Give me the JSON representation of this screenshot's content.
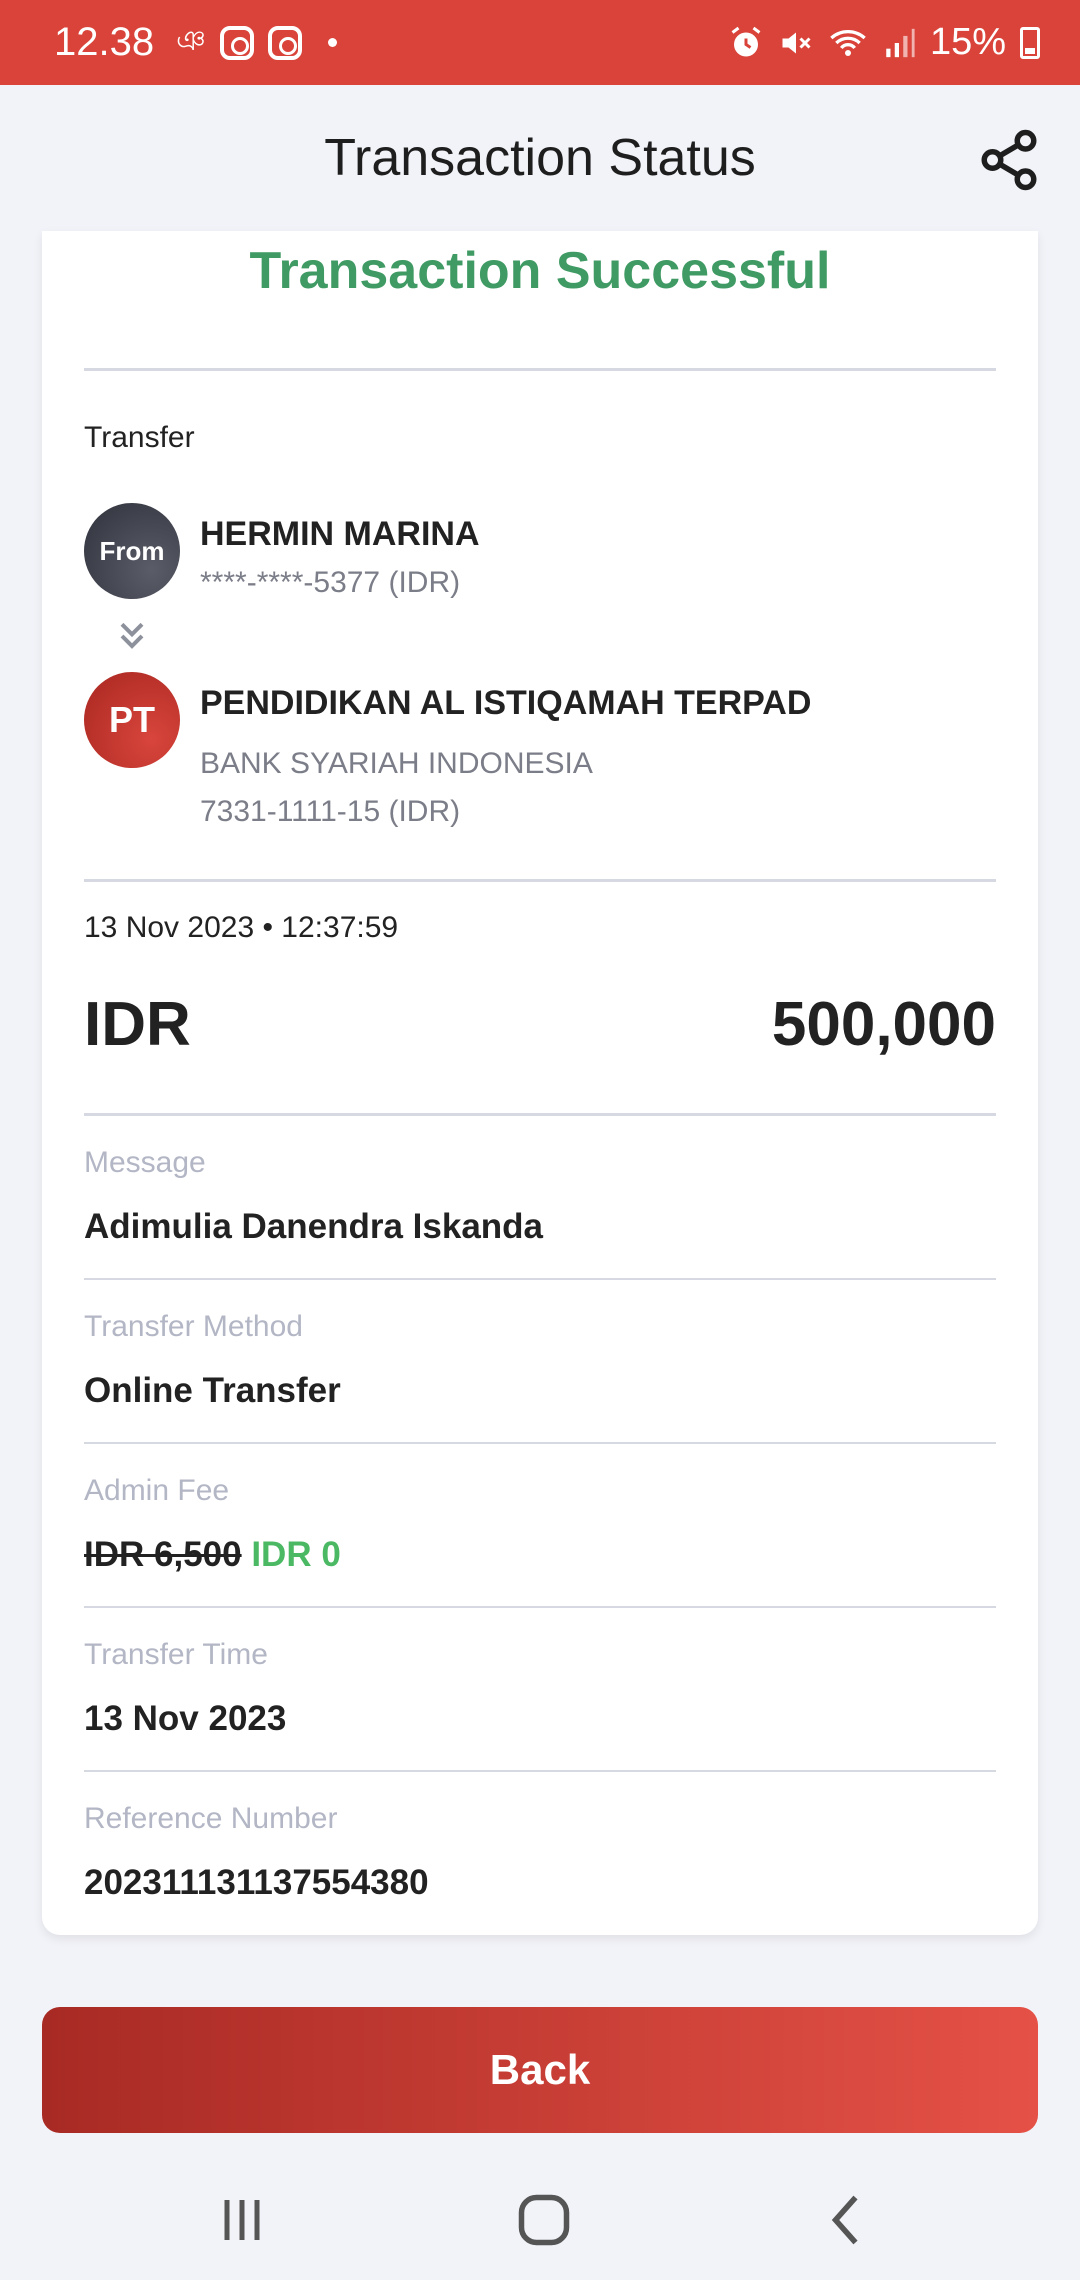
{
  "status_bar": {
    "time": "12.38",
    "battery": "15%",
    "left_icons": [
      "signal-text-icon",
      "instagram-icon",
      "instagram-icon",
      "dot-icon"
    ],
    "right_icons": [
      "alarm-icon",
      "mute-icon",
      "wifi-icon",
      "cell-signal-icon",
      "battery-icon"
    ]
  },
  "header": {
    "title": "Transaction Status",
    "share_icon": "share-icon"
  },
  "card": {
    "headline": "Transaction Successful",
    "type_label": "Transfer",
    "from": {
      "avatar_label": "From",
      "name": "HERMIN MARINA",
      "account": "****-****-5377 (IDR)"
    },
    "to": {
      "avatar_label": "PT",
      "name": "PENDIDIKAN AL ISTIQAMAH TERPAD",
      "bank": "BANK SYARIAH INDONESIA",
      "account": "7331-1111-15 (IDR)"
    },
    "datetime": "13 Nov 2023 • 12:37:59",
    "currency": "IDR",
    "amount": "500,000",
    "fields": {
      "message": {
        "label": "Message",
        "value": "Adimulia Danendra Iskanda"
      },
      "method": {
        "label": "Transfer Method",
        "value": "Online Transfer"
      },
      "fee": {
        "label": "Admin Fee",
        "original": "IDR 6,500",
        "value": "IDR 0"
      },
      "time": {
        "label": "Transfer Time",
        "value": "13 Nov 2023"
      },
      "reference": {
        "label": "Reference Number",
        "value": "20231113113755438​0"
      }
    }
  },
  "back_button": "Back",
  "colors": {
    "brand_red": "#d9433a",
    "success_green": "#3f9a63",
    "fee_green": "#4bb964"
  },
  "nav": [
    "recent-apps-icon",
    "home-icon",
    "back-icon"
  ]
}
